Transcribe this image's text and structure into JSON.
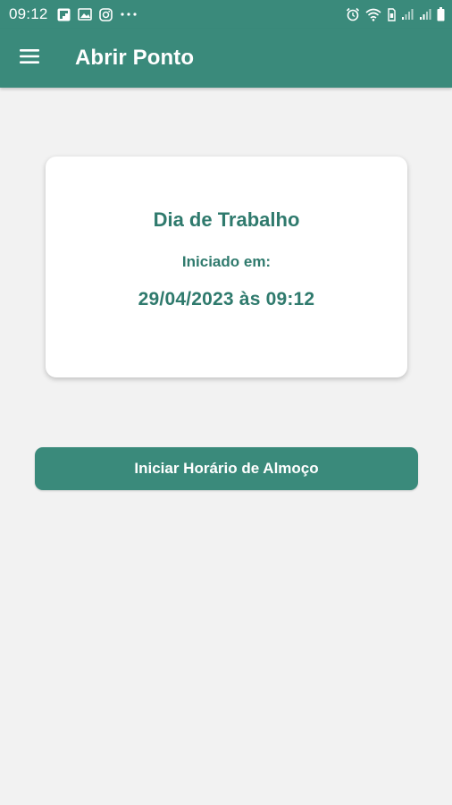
{
  "status_bar": {
    "time": "09:12",
    "left_icons": [
      "flipboard-icon",
      "image-icon",
      "instagram-icon",
      "more-dots-icon"
    ],
    "right_icons": [
      "alarm-icon",
      "wifi-icon",
      "sim-icon",
      "signal-icon",
      "signal-icon",
      "battery-icon"
    ]
  },
  "app_bar": {
    "title": "Abrir Ponto",
    "menu_icon": "hamburger-menu-icon"
  },
  "card": {
    "title": "Dia de Trabalho",
    "label": "Iniciado em:",
    "datetime": "29/04/2023 às 09:12"
  },
  "actions": {
    "lunch_button_label": "Iniciar Horário de Almoço"
  },
  "colors": {
    "primary": "#3a8a7b",
    "text_primary": "#2f7a6d",
    "background": "#f2f2f2",
    "card": "#ffffff"
  }
}
